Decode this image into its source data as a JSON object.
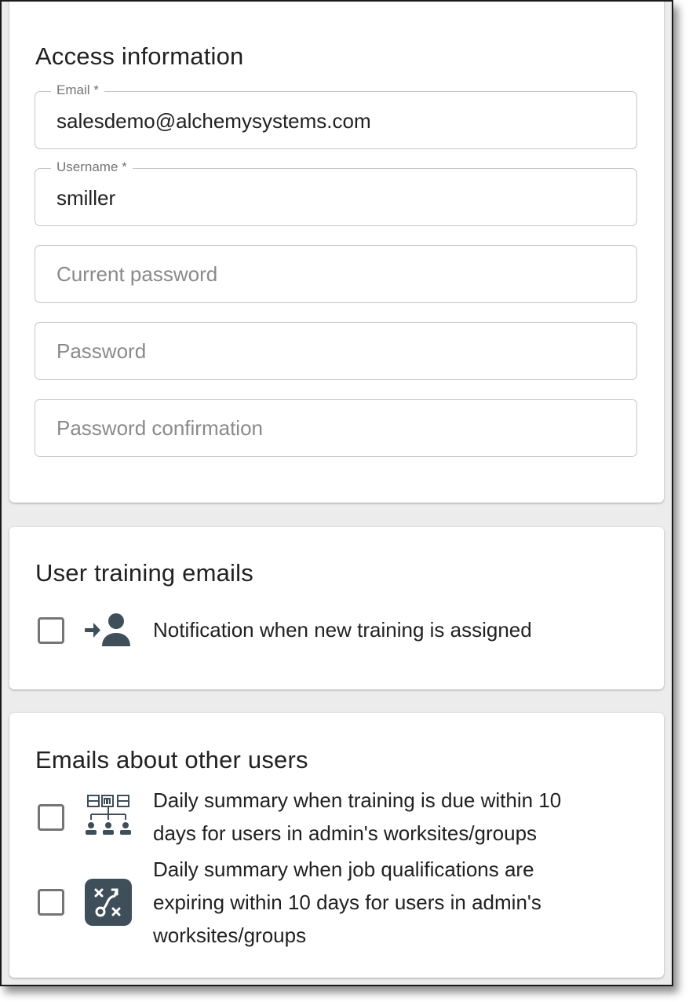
{
  "access": {
    "title": "Access information",
    "email": {
      "label": "Email *",
      "value": "salesdemo@alchemysystems.com"
    },
    "username": {
      "label": "Username *",
      "value": "smiller"
    },
    "current_password": {
      "placeholder": "Current password"
    },
    "password": {
      "placeholder": "Password"
    },
    "password_confirmation": {
      "placeholder": "Password confirmation"
    }
  },
  "training": {
    "title": "User training emails",
    "items": [
      {
        "label": "Notification when new training is assigned",
        "icon": "assign-user-icon",
        "checked": false
      }
    ]
  },
  "others": {
    "title": "Emails about other users",
    "items": [
      {
        "line1": "Daily summary when training is due within 10",
        "line2": "days for users in admin's worksites/groups",
        "icon": "org-hierarchy-icon",
        "checked": false
      },
      {
        "line1": "Daily summary when job qualifications are",
        "line2": "expiring within 10 days for users in admin's",
        "line3": "worksites/groups",
        "icon": "strategy-icon",
        "checked": false
      }
    ]
  },
  "colors": {
    "icon": "#3f4f5a",
    "border": "#c4c4c4",
    "checkbox": "#757575"
  }
}
